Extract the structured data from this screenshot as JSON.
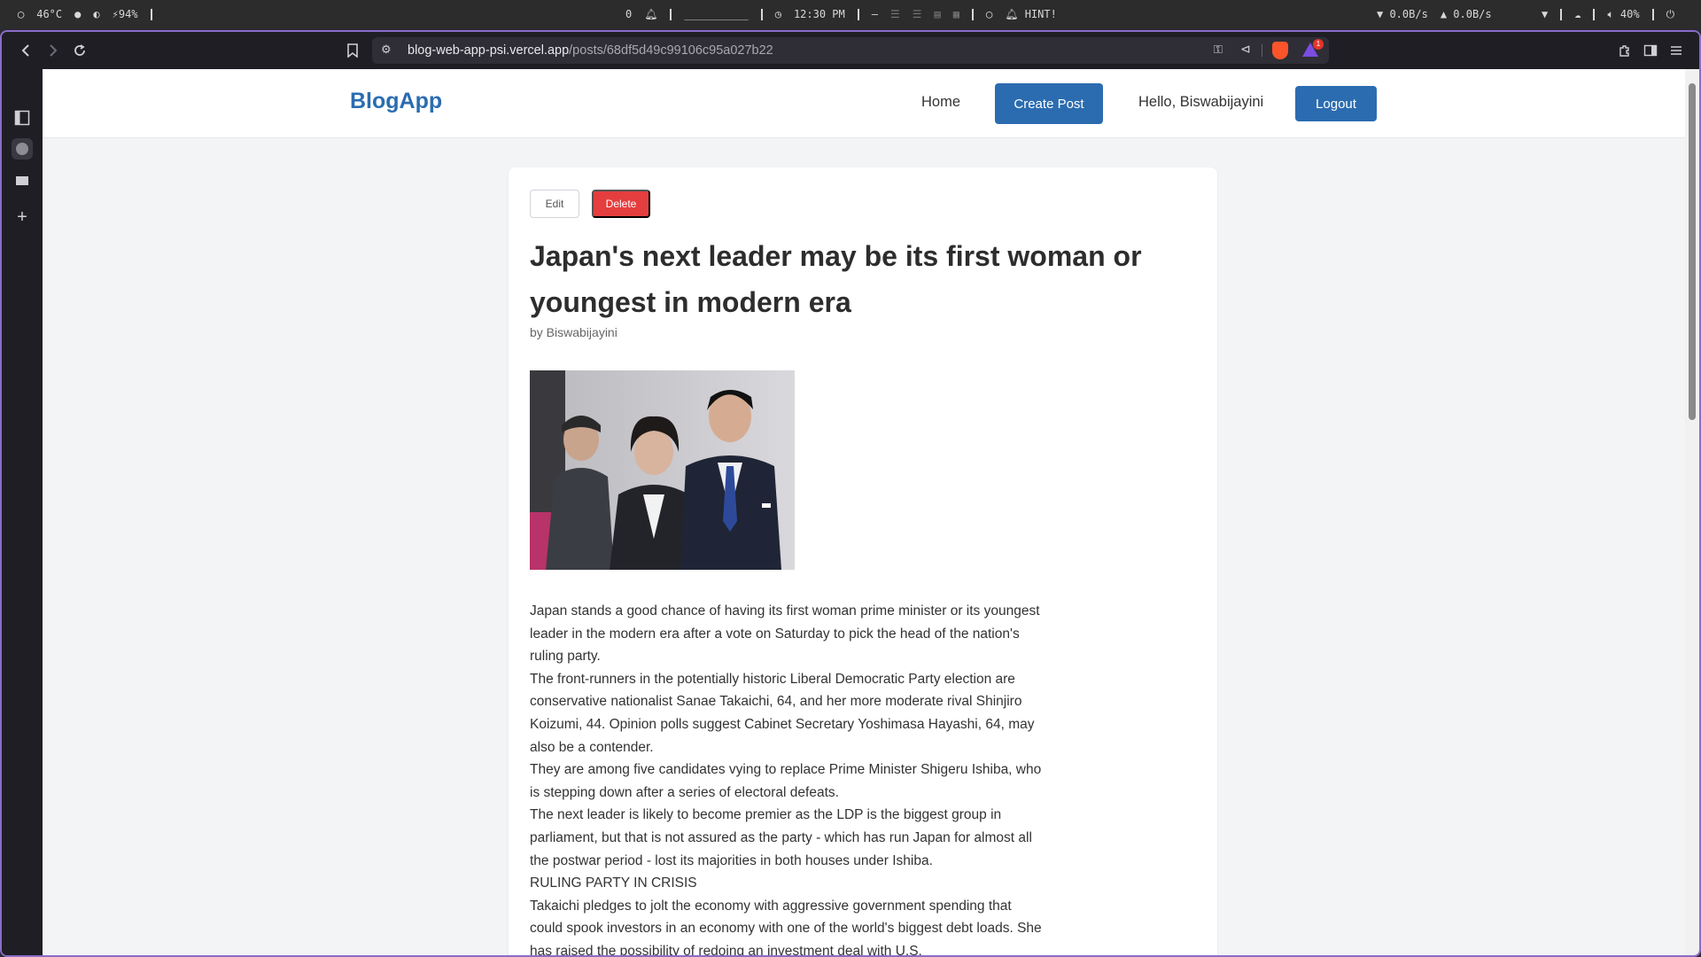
{
  "system_bar": {
    "temperature": "46°C",
    "battery": "94%",
    "notification_count": "0",
    "workspace_bar": "__________",
    "time": "12:30 PM",
    "hint": "HINT!",
    "net_down": "0.0B/s",
    "net_up": "0.0B/s",
    "volume": "40%"
  },
  "browser": {
    "url_host": "blog-web-app-psi.vercel.app",
    "url_path": "/posts/68df5d49c99106c95a027b22",
    "notification_badge": "1",
    "accent_color": "#8a6cc8"
  },
  "site": {
    "brand": "BlogApp",
    "nav": {
      "home": "Home",
      "create_post": "Create Post",
      "greeting": "Hello, Biswabijayini",
      "logout": "Logout"
    },
    "brand_color": "#2b6cb0"
  },
  "post": {
    "edit_label": "Edit",
    "delete_label": "Delete",
    "title": "Japan's next leader may be its first woman or youngest in modern era",
    "author": "by Biswabijayini",
    "paragraphs": [
      "Japan stands a good chance of having its first woman prime minister or its youngest leader in the modern era after a vote on Saturday to pick the head of the nation's ruling party.",
      "The front-runners in the potentially historic Liberal Democratic Party election are conservative nationalist Sanae Takaichi, 64, and her more moderate rival Shinjiro Koizumi, 44. Opinion polls suggest Cabinet Secretary Yoshimasa Hayashi, 64, may also be a contender.",
      "They are among five candidates vying to replace Prime Minister Shigeru Ishiba, who is stepping down after a series of electoral defeats.",
      "The next leader is likely to become premier as the LDP is the biggest group in parliament, but that is not assured as the party - which has run Japan for almost all the postwar period - lost its majorities in both houses under Ishiba.",
      "RULING PARTY IN CRISIS",
      "Takaichi pledges to jolt the economy with aggressive government spending that could spook investors in an economy with one of the world's biggest debt loads. She has raised the possibility of redoing an investment deal with U.S."
    ]
  }
}
